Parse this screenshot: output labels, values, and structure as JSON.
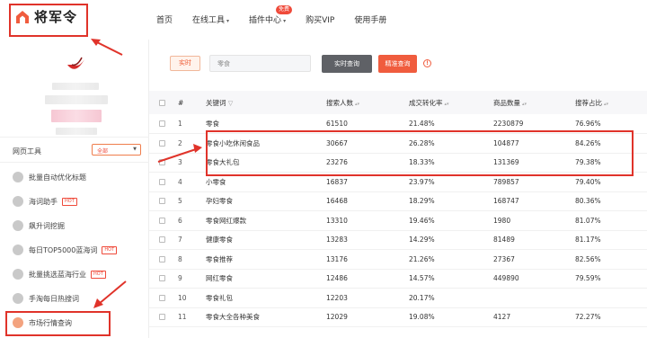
{
  "brand": {
    "name": "将军令"
  },
  "nav": [
    {
      "label": "首页",
      "caret": ""
    },
    {
      "label": "在线工具",
      "caret": "▾"
    },
    {
      "label": "插件中心",
      "caret": "▾",
      "badge": "免费"
    },
    {
      "label": "购买VIP",
      "caret": ""
    },
    {
      "label": "使用手册",
      "caret": ""
    }
  ],
  "sidebar": {
    "section_label": "网页工具",
    "filter_value": "全部",
    "items": [
      {
        "label": "批量自动优化标题",
        "hot": ""
      },
      {
        "label": "海词助手",
        "hot": "HOT"
      },
      {
        "label": "飙升词挖掘",
        "hot": ""
      },
      {
        "label": "每日TOP5000蓝海词",
        "hot": "HOT"
      },
      {
        "label": "批量挑选蓝海行业",
        "hot": "HOT"
      },
      {
        "label": "手淘每日热搜词",
        "hot": ""
      },
      {
        "label": "市场行情查询",
        "hot": ""
      }
    ]
  },
  "toolbar": {
    "tab_label": "实时",
    "input_value": "零食",
    "query_button": "实时查询",
    "precise_button": "精准查询",
    "help_glyph": "!"
  },
  "table": {
    "headers": {
      "index": "#",
      "keyword": "关键词",
      "search": "搜索人数",
      "conversion": "成交转化率",
      "goods": "商品数量",
      "ratio": "搜荐占比"
    },
    "rows": [
      {
        "index": "1",
        "keyword": "零食",
        "search": "61510",
        "conversion": "21.48%",
        "goods": "2230879",
        "ratio": "76.96%"
      },
      {
        "index": "2",
        "keyword": "零食小吃休闲食品",
        "search": "30667",
        "conversion": "26.28%",
        "goods": "104877",
        "ratio": "84.26%"
      },
      {
        "index": "3",
        "keyword": "零食大礼包",
        "search": "23276",
        "conversion": "18.33%",
        "goods": "131369",
        "ratio": "79.38%"
      },
      {
        "index": "4",
        "keyword": "小零食",
        "search": "16837",
        "conversion": "23.97%",
        "goods": "789857",
        "ratio": "79.40%"
      },
      {
        "index": "5",
        "keyword": "孕妇零食",
        "search": "16468",
        "conversion": "18.29%",
        "goods": "168747",
        "ratio": "80.36%"
      },
      {
        "index": "6",
        "keyword": "零食网红爆款",
        "search": "13310",
        "conversion": "19.46%",
        "goods": "1980",
        "ratio": "81.07%"
      },
      {
        "index": "7",
        "keyword": "健康零食",
        "search": "13283",
        "conversion": "14.29%",
        "goods": "81489",
        "ratio": "81.17%"
      },
      {
        "index": "8",
        "keyword": "零食推荐",
        "search": "13176",
        "conversion": "21.26%",
        "goods": "27367",
        "ratio": "82.56%"
      },
      {
        "index": "9",
        "keyword": "网红零食",
        "search": "12486",
        "conversion": "14.57%",
        "goods": "449890",
        "ratio": "79.59%"
      },
      {
        "index": "10",
        "keyword": "零食礼包",
        "search": "12203",
        "conversion": "20.17%",
        "goods": "",
        "ratio": ""
      },
      {
        "index": "11",
        "keyword": "零食大全各种美食",
        "search": "12029",
        "conversion": "19.08%",
        "goods": "4127",
        "ratio": "72.27%"
      }
    ]
  },
  "colors": {
    "accent": "#f05c3e",
    "annotation": "#e0332a",
    "query_button": "#5f6166"
  }
}
